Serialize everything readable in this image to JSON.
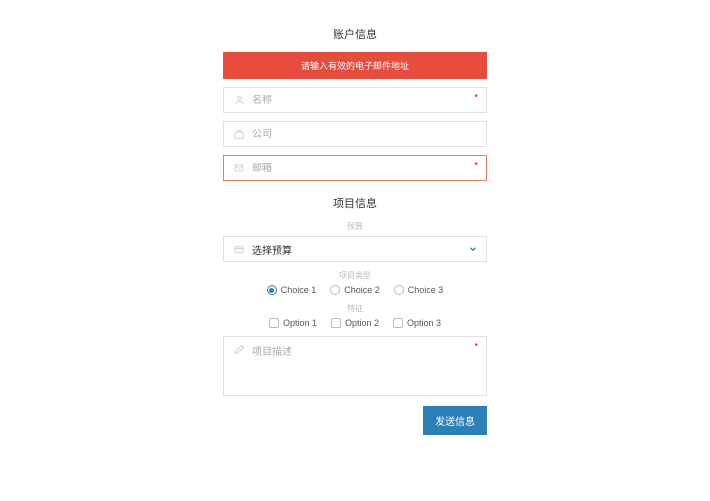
{
  "section1": {
    "title": "账户信息",
    "alert": "请输入有效的电子邮件地址",
    "name_placeholder": "名称",
    "company_placeholder": "公司",
    "email_placeholder": "邮箱"
  },
  "section2": {
    "title": "项目信息",
    "budget_label": "预算",
    "budget_select": "选择预算",
    "type_label": "项目类型",
    "choices": [
      "Choice 1",
      "Choice 2",
      "Choice 3"
    ],
    "choice_selected": 0,
    "feature_label": "特征",
    "options": [
      "Option 1",
      "Option 2",
      "Option 3"
    ],
    "desc_placeholder": "项目描述"
  },
  "submit_label": "发送信息"
}
